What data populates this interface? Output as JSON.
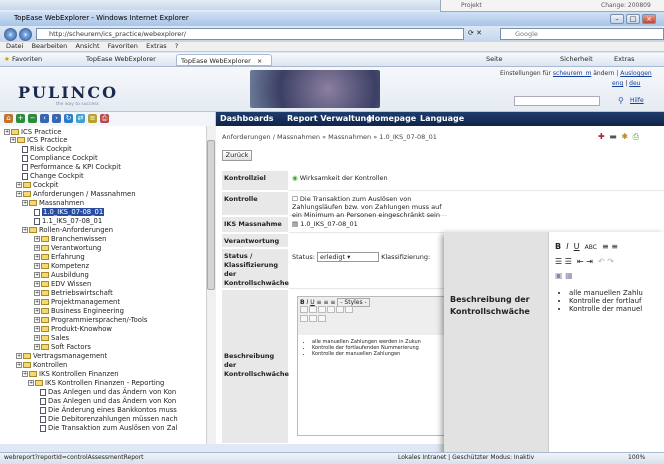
{
  "background_window": {
    "tree_item": "Projekt",
    "change_text": "Change: 200809"
  },
  "browser": {
    "title": "TopEase WebExplorer - Windows Internet Explorer",
    "url": "http://scheurem/ics_practice/webexplorer/",
    "search_engine": "Google",
    "menu": [
      "Datei",
      "Bearbeiten",
      "Ansicht",
      "Favoriten",
      "Extras",
      "?"
    ],
    "favorites_label": "Favoriten",
    "fav_link": "TopEase WebExplorer",
    "tab_label": "TopEase WebExplorer",
    "cmd": [
      "Seite",
      "Sicherheit",
      "Extras"
    ],
    "status_url": "webreport?reportId=controlAssessmentReport",
    "status_zone": "Lokales Intranet | Geschützter Modus: Inaktiv",
    "zoom": "100%"
  },
  "header": {
    "logo": "PULINCO",
    "slogan": "the way to success",
    "settings_text": "Einstellungen für",
    "user": "scheurem_m",
    "change_text": "ändern |",
    "logout": "Ausloggen",
    "lang_en": "eng",
    "lang_de": "deu",
    "help": "Hilfe"
  },
  "nav": [
    "Dashboards",
    "Report Verwaltung",
    "Homepage",
    "Language"
  ],
  "tree": [
    {
      "label": "ICS Practice",
      "icon": "folder"
    },
    {
      "label": "ICS Practice",
      "icon": "folder"
    },
    {
      "label": "Risk Cockpit",
      "icon": "doc"
    },
    {
      "label": "Compliance Cockpit",
      "icon": "doc"
    },
    {
      "label": "Performance & KPI Cockpit",
      "icon": "doc"
    },
    {
      "label": "Change Cockpit",
      "icon": "doc"
    },
    {
      "label": "Cockpit",
      "icon": "folder"
    },
    {
      "label": "Anforderungen / Massnahmen",
      "icon": "folder"
    },
    {
      "label": "Massnahmen",
      "icon": "folder"
    },
    {
      "label": "1.0_IKS_07-08_01",
      "icon": "doc",
      "selected": true
    },
    {
      "label": "1.1_IKS_07-08_01",
      "icon": "doc"
    },
    {
      "label": "Rollen-Anforderungen",
      "icon": "folder"
    },
    {
      "label": "Branchenwissen",
      "icon": "folder"
    },
    {
      "label": "Verantwortung",
      "icon": "folder"
    },
    {
      "label": "Erfahrung",
      "icon": "folder"
    },
    {
      "label": "Kompetenz",
      "icon": "folder"
    },
    {
      "label": "Ausbildung",
      "icon": "folder"
    },
    {
      "label": "EDV Wissen",
      "icon": "folder"
    },
    {
      "label": "Betriebswirtschaft",
      "icon": "folder"
    },
    {
      "label": "Projektmanagement",
      "icon": "folder"
    },
    {
      "label": "Business Engineering",
      "icon": "folder"
    },
    {
      "label": "Programmiersprachen/-Tools",
      "icon": "folder"
    },
    {
      "label": "Produkt-Knowhow",
      "icon": "folder"
    },
    {
      "label": "Sales",
      "icon": "folder"
    },
    {
      "label": "Soft Factors",
      "icon": "folder"
    },
    {
      "label": "Vertragsmanagement",
      "icon": "folder"
    },
    {
      "label": "Kontrollen",
      "icon": "folder"
    },
    {
      "label": "IKS Kontrollen Finanzen",
      "icon": "folder"
    },
    {
      "label": "IKS Kontrollen Finanzen - Reporting",
      "icon": "folder"
    },
    {
      "label": "Das Anlegen und das Ändern von Kon",
      "icon": "doc"
    },
    {
      "label": "Das Anlegen und das Ändern von Kon",
      "icon": "doc"
    },
    {
      "label": "Die Änderung eines Bankkontos muss",
      "icon": "doc"
    },
    {
      "label": "Die Debitorenzahlungen müssen nach",
      "icon": "doc"
    },
    {
      "label": "Die Transaktion zum Auslösen von Zal",
      "icon": "doc"
    }
  ],
  "content": {
    "breadcrumb": "Anforderungen / Massnahmen » Massnahmen » 1.0_IKS_07-08_01",
    "back": "Zurück",
    "rows": [
      {
        "label": "Kontrollziel",
        "value": "Wirksamkeit der Kontrollen"
      },
      {
        "label": "Kontrolle",
        "value": "Die Transaktion zum Auslösen von Zahlungsläufen bzw. von Zahlungen muss auf ein Minimum an Personen eingeschränkt sein"
      },
      {
        "label": "IKS Massnahme",
        "value": "1.0_IKS_07-08_01"
      },
      {
        "label": "Verantwortung",
        "value": ""
      },
      {
        "label": "Status / Klassifizierung der Kontrollschwäche",
        "status_label": "Status:",
        "status_value": "erledigt",
        "class_label": "Klassifizierung:"
      },
      {
        "label": "Beschreibung der Kontrollschwäche"
      }
    ],
    "editor_styles": "- Styles -",
    "bullets": [
      "alle manuellen Zahlungen werden in Zukun",
      "Kontrolle der fortlaufenden Nummerierung",
      "Kontrolle der manuellen Zahlungen"
    ]
  },
  "overlay": {
    "label": "Beschreibung der Kontrollschwäche",
    "bullets": [
      "alle manuellen Zahlu",
      "Kontrolle der fortlauf",
      "Kontrolle der manuel"
    ]
  }
}
